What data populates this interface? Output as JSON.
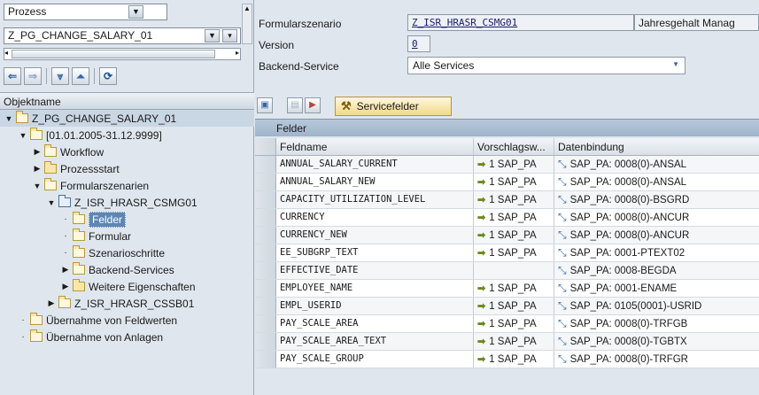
{
  "left": {
    "type_combo": "Prozess",
    "process_combo": "Z_PG_CHANGE_SALARY_01",
    "object_header": "Objektname",
    "tree": [
      {
        "label": "Z_PG_CHANGE_SALARY_01"
      },
      {
        "label": "[01.01.2005-31.12.9999]"
      },
      {
        "label": "Workflow"
      },
      {
        "label": "Prozessstart"
      },
      {
        "label": "Formularszenarien"
      },
      {
        "label": "Z_ISR_HRASR_CSMG01"
      },
      {
        "label": "Felder"
      },
      {
        "label": "Formular"
      },
      {
        "label": "Szenarioschritte"
      },
      {
        "label": "Backend-Services"
      },
      {
        "label": "Weitere Eigenschaften"
      },
      {
        "label": "Z_ISR_HRASR_CSSB01"
      },
      {
        "label": "Übernahme von Feldwerten"
      },
      {
        "label": "Übernahme von Anlagen"
      }
    ]
  },
  "right": {
    "scenario_label": "Formularszenario",
    "scenario_value": "Z_ISR_HRASR_CSMG01",
    "scenario_desc": "Jahresgehalt Manag",
    "version_label": "Version",
    "version_value": "0",
    "backend_label": "Backend-Service",
    "backend_value": "Alle Services",
    "service_button": "Servicefelder",
    "table_title": "Felder",
    "columns": [
      "Feldname",
      "Vorschlagsw...",
      "Datenbindung"
    ],
    "rows": [
      {
        "field": "ANNUAL_SALARY_CURRENT",
        "default": "1 SAP_PA",
        "binding": "SAP_PA: 0008(0)-ANSAL"
      },
      {
        "field": "ANNUAL_SALARY_NEW",
        "default": "1 SAP_PA",
        "binding": "SAP_PA: 0008(0)-ANSAL"
      },
      {
        "field": "CAPACITY_UTILIZATION_LEVEL",
        "default": "1 SAP_PA",
        "binding": "SAP_PA: 0008(0)-BSGRD"
      },
      {
        "field": "CURRENCY",
        "default": "1 SAP_PA",
        "binding": "SAP_PA: 0008(0)-ANCUR"
      },
      {
        "field": "CURRENCY_NEW",
        "default": "1 SAP_PA",
        "binding": "SAP_PA: 0008(0)-ANCUR"
      },
      {
        "field": "EE_SUBGRP_TEXT",
        "default": "1 SAP_PA",
        "binding": "SAP_PA: 0001-PTEXT02"
      },
      {
        "field": "EFFECTIVE_DATE",
        "default": "",
        "binding": "SAP_PA: 0008-BEGDA"
      },
      {
        "field": "EMPLOYEE_NAME",
        "default": "1 SAP_PA",
        "binding": "SAP_PA: 0001-ENAME"
      },
      {
        "field": "EMPL_USERID",
        "default": "1 SAP_PA",
        "binding": "SAP_PA: 0105(0001)-USRID"
      },
      {
        "field": "PAY_SCALE_AREA",
        "default": "1 SAP_PA",
        "binding": "SAP_PA: 0008(0)-TRFGB"
      },
      {
        "field": "PAY_SCALE_AREA_TEXT",
        "default": "1 SAP_PA",
        "binding": "SAP_PA: 0008(0)-TGBTX"
      },
      {
        "field": "PAY_SCALE_GROUP",
        "default": "1 SAP_PA",
        "binding": "SAP_PA: 0008(0)-TRFGR"
      }
    ]
  }
}
